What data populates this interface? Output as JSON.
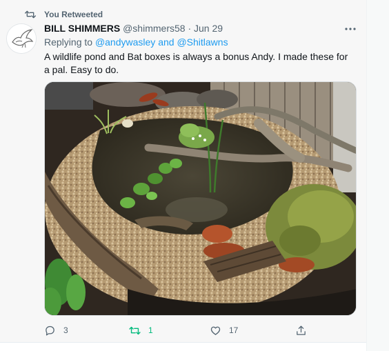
{
  "retweet_banner": {
    "icon": "retweet-icon",
    "text": "You Retweeted"
  },
  "tweet": {
    "display_name": "BILL SHIMMERS",
    "handle": "@shimmers58",
    "separator": "·",
    "date": "Jun 29",
    "replying": {
      "prefix": "Replying to ",
      "mention_1": "@andywasley",
      "joiner": " and ",
      "mention_2": "@Shitlawns"
    },
    "text": "A wildlife pond and Bat boxes is always a bonus Andy. I made these for a pal. Easy to do.",
    "media_alt": "Garden wildlife pond edged with logs, gravel and moss"
  },
  "actions": {
    "reply_count": "3",
    "retweet_count": "1",
    "like_count": "17"
  },
  "colors": {
    "accent": "#1d9bf0",
    "retweet_active": "#00ba7c",
    "secondary_text": "#536471"
  },
  "icons": [
    "retweet-icon",
    "more-icon",
    "reply-icon",
    "retweet-icon",
    "like-icon",
    "share-icon",
    "bird-avatar-icon"
  ]
}
